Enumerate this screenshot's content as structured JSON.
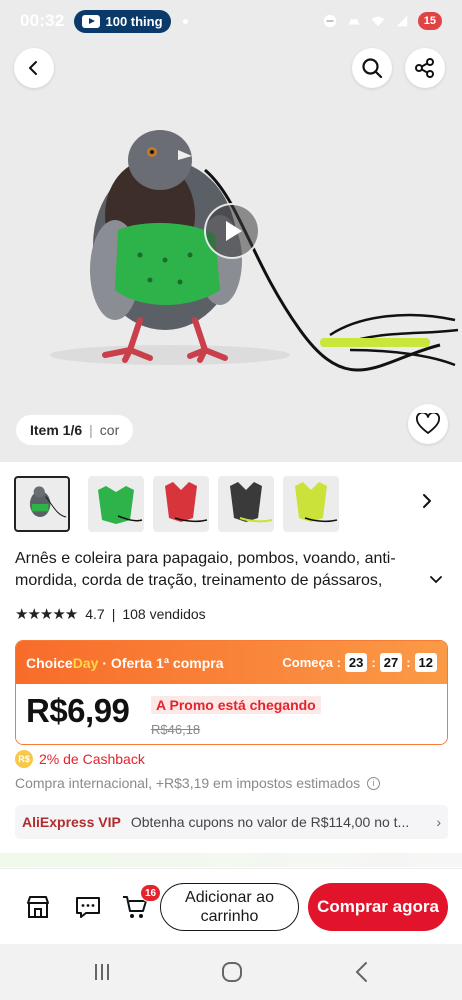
{
  "status_bar": {
    "time": "00:32",
    "pill_label": "100 thing",
    "battery": "15"
  },
  "hero": {
    "item_counter": "Item 1/6",
    "variant_label": "cor"
  },
  "thumbnails": [
    {
      "color": "#2db34a",
      "selected": true
    },
    {
      "color": "#2db34a",
      "selected": false
    },
    {
      "color": "#d8343c",
      "selected": false
    },
    {
      "color": "#3a3a3a",
      "selected": false
    },
    {
      "color": "#cbe23a",
      "selected": false
    }
  ],
  "product": {
    "title": "Arnês e coleira para papagaio, pombos, voando, anti-mordida, corda de tração, treinamento de pássaros,",
    "stars": "★★★★★",
    "rating": "4.7",
    "sold": "108 vendidos"
  },
  "choice": {
    "brand": "Choice",
    "day": "Day",
    "offer": "· Oferta 1ª compra",
    "starts_label": "Começa :",
    "hours": "23",
    "minutes": "27",
    "seconds": "12",
    "price": "R$6,99",
    "promo_tag": "A Promo está chegando",
    "old_price": "R$46,18"
  },
  "cashback": {
    "label": "2% de Cashback",
    "icon_text": "R$"
  },
  "import_text": "Compra internacional, +R$3,19 em impostos estimados",
  "vip": {
    "brand": "AliExpress",
    "vip": "VIP",
    "text": "Obtenha cupons no valor de R$114,00 no t..."
  },
  "bottom_bar": {
    "cart_count": "16",
    "add_to_cart": "Adicionar ao carrinho",
    "buy_now": "Comprar agora"
  },
  "colors": {
    "accent_red": "#e1142b",
    "choice_orange": "#f86c2a",
    "harness_green": "#2db34a"
  }
}
